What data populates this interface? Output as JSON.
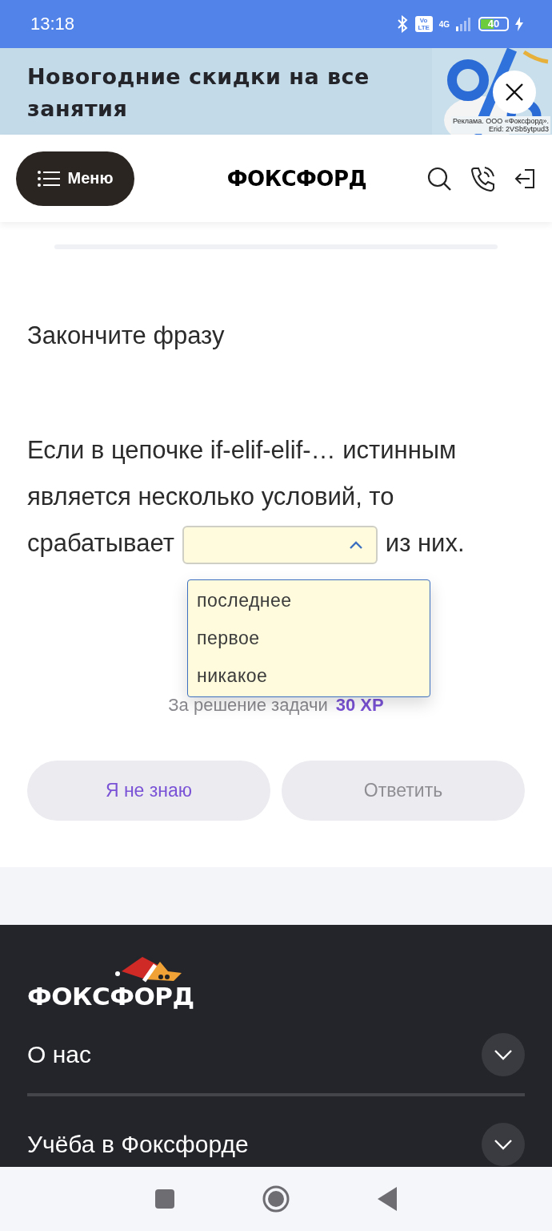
{
  "status_bar": {
    "time": "13:18",
    "volte": "Vo LTE",
    "network": "4G",
    "battery": "40"
  },
  "banner": {
    "title": "Новогодние скидки на все занятия",
    "disclaimer": "Реклама. ООО «Фоксфорд». Erid: 2VSb5ytpud3"
  },
  "header": {
    "menu_label": "Меню",
    "logo": "ФОКСФОРД"
  },
  "task": {
    "prompt": "Закончите фразу",
    "question": {
      "lines": [
        "Если в цепочке if-elif-elif-… истинным",
        "является несколько условий, то"
      ],
      "text_before": "срабатывает",
      "text_after": "из них.",
      "answer": {
        "expanded": true,
        "options": [
          {
            "label": "последнее",
            "selected": false
          },
          {
            "label": "первое",
            "selected": false
          },
          {
            "label": "никакое",
            "selected": false
          }
        ]
      }
    },
    "reward": {
      "label": "За решение задачи",
      "value": "30 XP"
    },
    "buttons": [
      {
        "label": "Я не знаю",
        "disabled": false
      },
      {
        "label": "Ответить",
        "disabled": true
      }
    ]
  },
  "footer": {
    "logo": "ФОКСФОРД",
    "sections": [
      {
        "title": "О нас",
        "expanded": false
      },
      {
        "title": "Учёба в Фоксфорде",
        "expanded": false
      }
    ]
  }
}
